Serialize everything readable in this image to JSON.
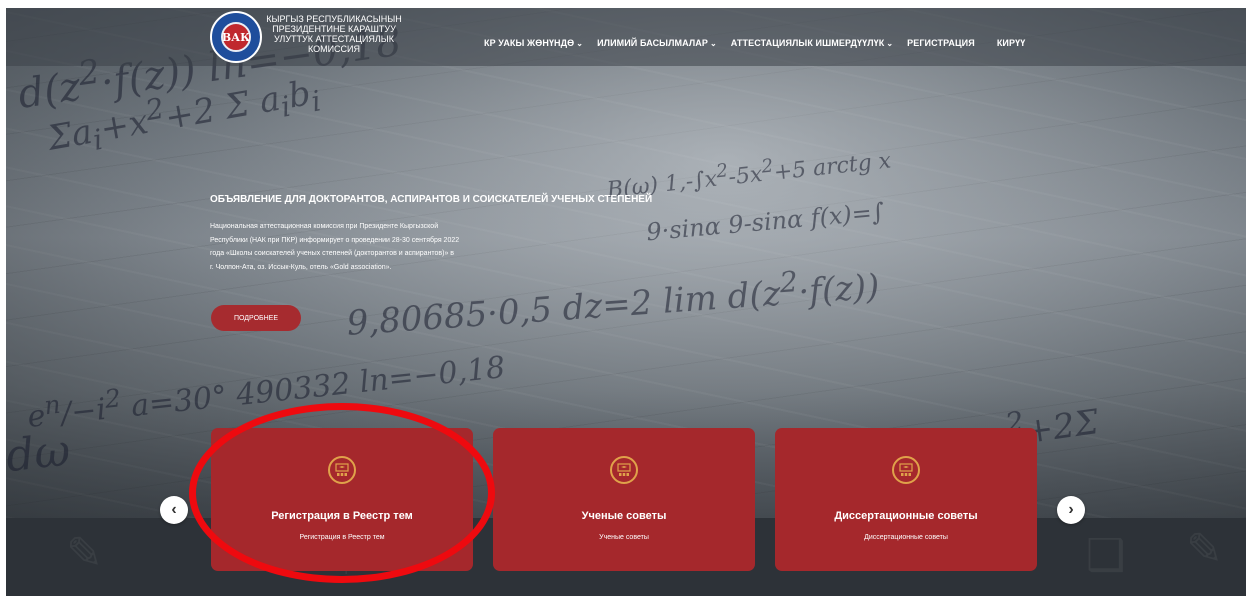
{
  "header": {
    "logo_text": "ВАК",
    "org_lines": [
      "КЫРГЫЗ РЕСПУБЛИКАСЫНЫН",
      "ПРЕЗИДЕНТИНЕ КАРАШТУУ",
      "УЛУТТУК АТТЕСТАЦИЯЛЫК",
      "КОМИССИЯ"
    ],
    "nav": [
      {
        "label": "КР УАКЫ ЖӨНҮНДӨ",
        "has_dropdown": true
      },
      {
        "label": "ИЛИМИЙ БАСЫЛМАЛАР",
        "has_dropdown": true
      },
      {
        "label": "АТТЕСТАЦИЯЛЫК ИШМЕРДҮҮЛҮК",
        "has_dropdown": true
      },
      {
        "label": "РЕГИСТРАЦИЯ",
        "has_dropdown": false
      },
      {
        "label": "КИРҮҮ",
        "has_dropdown": false
      }
    ]
  },
  "hero": {
    "title": "ОБЪЯВЛЕНИЕ ДЛЯ ДОКТОРАНТОВ, АСПИРАНТОВ И СОИСКАТЕЛЕЙ УЧЕНЫХ СТЕПЕНЕЙ",
    "text_lines": [
      "Национальная аттестационная комиссия при Президенте Кыргызской",
      "Республики (НАК при ПКР) информирует о проведении 28-30 сентября 2022",
      "года «Школы соискателей ученых степеней (докторантов и аспирантов)» в",
      "г. Чолпон-Ата, оз. Иссык-Куль, отель «Gold association»."
    ],
    "button_label": "ПОДРОБНЕЕ"
  },
  "cards": [
    {
      "title": "Регистрация в Реестр тем",
      "subtitle": "Регистрация в Реестр тем",
      "icon": "presentation-board-icon"
    },
    {
      "title": "Ученые советы",
      "subtitle": "Ученые советы",
      "icon": "presentation-board-icon"
    },
    {
      "title": "Диссертационные советы",
      "subtitle": "Диссертационные советы",
      "icon": "presentation-board-icon"
    }
  ],
  "carousel": {
    "prev": "‹",
    "next": "›"
  },
  "colors": {
    "card_bg": "#a5282c",
    "button_bg": "#a62b2f",
    "icon_ring": "#e0a24a",
    "annotation": "#ee0a0f",
    "footer_band": "#2d3238"
  }
}
